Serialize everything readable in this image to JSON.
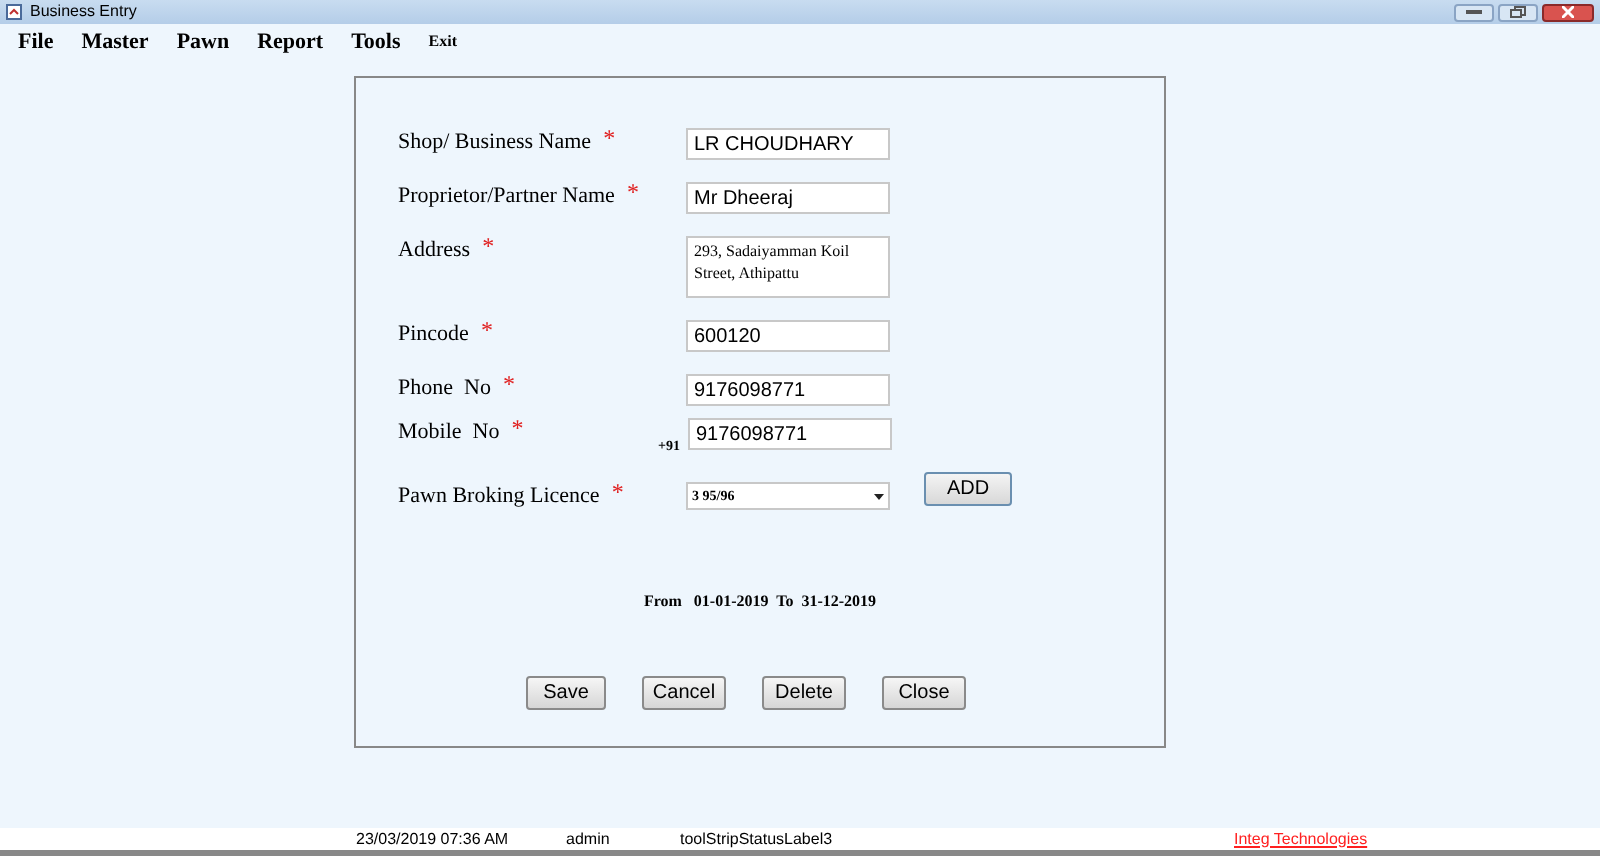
{
  "window": {
    "title": "Business Entry"
  },
  "menu": [
    "File",
    "Master",
    "Pawn",
    "Report",
    "Tools",
    "Exit"
  ],
  "fields": [
    {
      "kind": "text",
      "label": "Shop/ Business Name",
      "marker": "*",
      "value": "LR CHOUDHARY"
    },
    {
      "kind": "text",
      "label": "Proprietor/Partner Name",
      "marker": "*",
      "value": "Mr Dheeraj"
    },
    {
      "kind": "textarea",
      "label": "Address",
      "marker": "*",
      "value": "293, Sadaiyamman Koil Street, Athipattu"
    },
    {
      "kind": "text",
      "label": "Pincode",
      "marker": "*",
      "value": "600120"
    },
    {
      "kind": "text",
      "label": "Phone  No",
      "marker": "*",
      "value": "9176098771"
    },
    {
      "kind": "text",
      "label": "Mobile  No",
      "marker": "*",
      "prefix": "+91",
      "value": "9176098771"
    },
    {
      "kind": "select",
      "label": "Pawn Broking Licence",
      "marker": "*",
      "value": "3 95/96",
      "button": "ADD"
    }
  ],
  "period": "From   01-01-2019  To  31-12-2019",
  "buttons": [
    "Save",
    "Cancel",
    "Delete",
    "Close"
  ],
  "status_bar": {
    "datetime": "23/03/2019 07:36 AM",
    "user": "admin",
    "label": "toolStripStatusLabel3",
    "link": "Integ Technologies"
  }
}
